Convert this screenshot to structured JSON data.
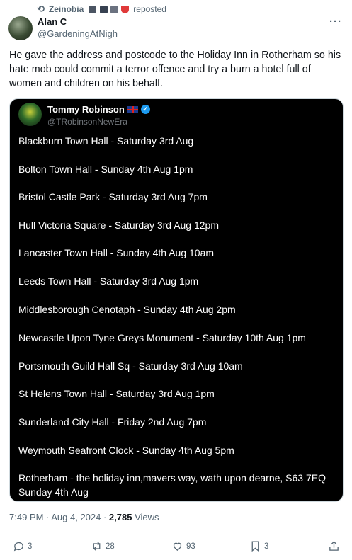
{
  "repost": {
    "name": "Zeinobia",
    "label": "reposted"
  },
  "post": {
    "author_name": "Alan C",
    "author_handle": "@GardeningAtNigh",
    "text": "He gave the address and postcode to the Holiday Inn in Rotherham so his hate mob could commit a terror offence and try a burn a hotel full of women and children on his behalf.",
    "timestamp": "7:49 PM · Aug 4, 2024 · ",
    "views_count": "2,785",
    "views_label": " Views"
  },
  "embed": {
    "name": "Tommy Robinson",
    "handle": "@TRobinsonNewEra",
    "lines": [
      "Blackburn Town Hall - Saturday 3rd Aug",
      "Bolton Town Hall - Sunday 4th Aug 1pm",
      "Bristol Castle Park - Saturday 3rd Aug 7pm",
      "Hull Victoria Square - Saturday 3rd Aug 12pm",
      "Lancaster Town Hall - Sunday 4th Aug 10am",
      "Leeds Town Hall - Saturday 3rd Aug 1pm",
      "Middlesborough Cenotaph - Sunday 4th Aug 2pm",
      "Newcastle Upon Tyne Greys Monument - Saturday 10th Aug 1pm",
      "Portsmouth Guild Hall Sq - Saturday  3rd Aug 10am",
      "St Helens Town Hall - Saturday 3rd Aug 1pm",
      "Sunderland City Hall - Friday 2nd Aug 7pm",
      "Weymouth Seafront Clock - Sunday 4th Aug 5pm",
      "Rotherham - the holiday inn,mavers way, wath upon dearne, S63 7EQ Sunday 4th Aug"
    ]
  },
  "actions": {
    "replies": "3",
    "reposts": "28",
    "likes": "93",
    "bookmarks": "3"
  },
  "icons": {
    "repost": "repost-icon",
    "more": "more-icon",
    "verified": "verified-badge-icon",
    "flag": "uk-flag-icon"
  },
  "colors": {
    "accent": "#1d9bf0",
    "secondary_text": "#536471"
  }
}
